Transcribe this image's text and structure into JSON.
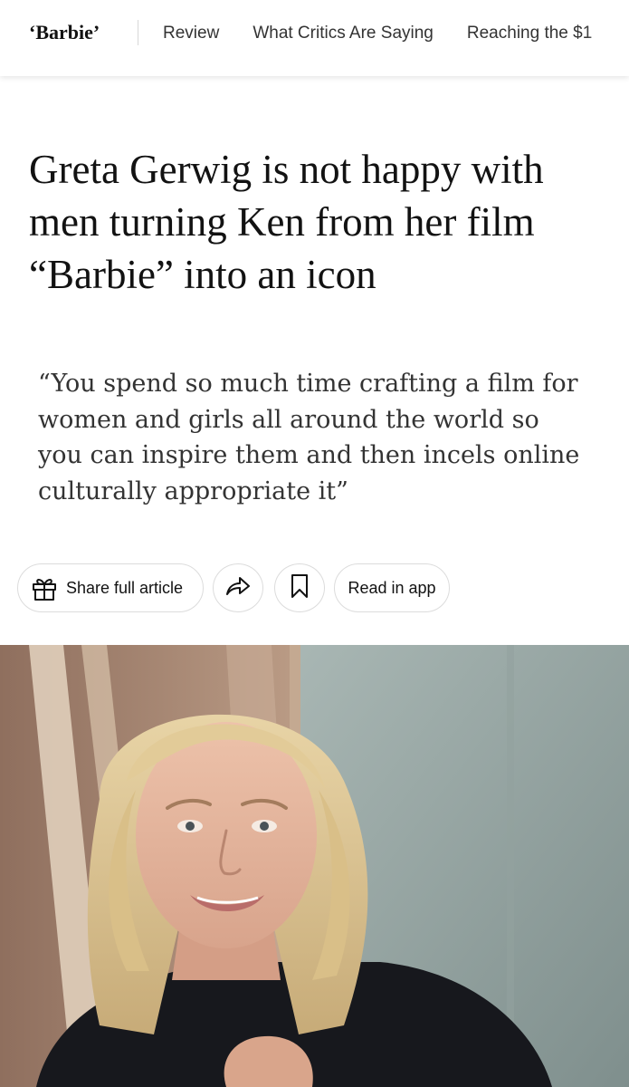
{
  "nav": {
    "brand": "‘Barbie’",
    "links": [
      {
        "label": "Review"
      },
      {
        "label": "What Critics Are Saying"
      },
      {
        "label": "Reaching the $1"
      }
    ]
  },
  "article": {
    "headline": "Greta Gerwig is not happy with men turning Ken from her film “Barbie” into an icon",
    "summary": "“You spend so much time crafting a film for women and girls all around the world so you can inspire them and then incels online culturally appropriate it”"
  },
  "actions": {
    "share_label": "Share full article",
    "share_icon": "gift-icon",
    "forward_icon": "share-arrow-icon",
    "save_icon": "bookmark-icon",
    "app_label": "Read in app"
  },
  "photo": {
    "subject": "portrait-photo"
  }
}
